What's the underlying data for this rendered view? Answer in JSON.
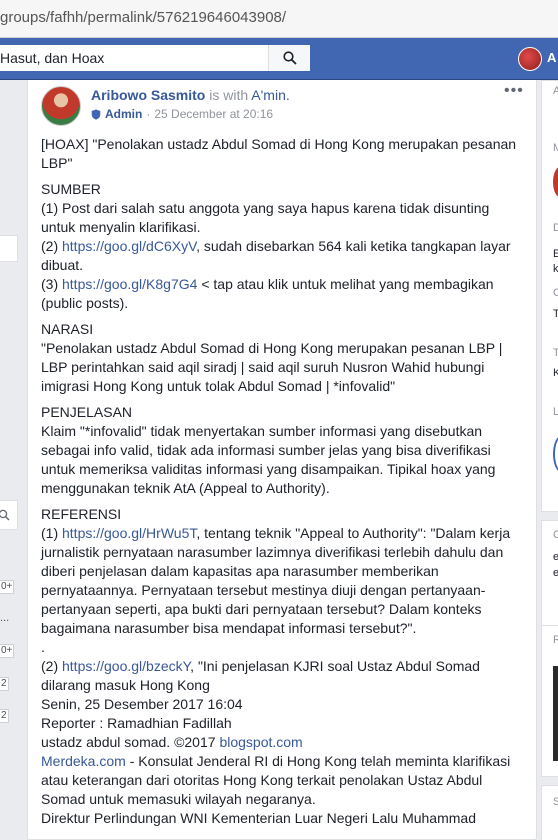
{
  "browser": {
    "url": "groups/fafhh/permalink/576219646043908/"
  },
  "topbar": {
    "search_text": "Hasut, dan Hoax",
    "user_initial": "A"
  },
  "left_sidebar": {
    "badges": [
      "0+",
      "0+",
      "2",
      "2"
    ],
    "ellipsis": "..."
  },
  "right_sidebar": {
    "letters": [
      "A",
      "M",
      "D",
      "E",
      "k",
      "C",
      "T",
      "T",
      "K",
      "L",
      "C",
      "e",
      "e",
      "R",
      "S"
    ]
  },
  "post": {
    "author": "Aribowo Sasmito",
    "with_text": "is with",
    "with_place": "A'min.",
    "role": "Admin",
    "separator": "·",
    "timestamp": "25 December at 20:16",
    "more": "•••",
    "content": {
      "headline": "[HOAX] \"Penolakan ustadz Abdul Somad di Hong Kong merupakan pesanan LBP\"",
      "sumber_title": "SUMBER",
      "sumber_1": "(1) Post dari salah satu anggota yang saya hapus karena tidak disunting untuk menyalin klarifikasi.",
      "sumber_2_prefix": "(2) ",
      "sumber_2_link": "https://goo.gl/dC6XyV",
      "sumber_2_rest": ", sudah disebarkan 564 kali ketika tangkapan layar dibuat.",
      "sumber_3_prefix": "(3) ",
      "sumber_3_link": "https://goo.gl/K8g7G4",
      "sumber_3_rest": " < tap atau klik untuk melihat yang membagikan (public posts).",
      "narasi_title": "NARASI",
      "narasi_text": "\"Penolakan ustadz Abdul Somad di Hong Kong merupakan pesanan LBP | LBP perintahkan said aqil siradj | said aqil suruh Nusron Wahid hubungi imigrasi Hong Kong untuk tolak Abdul Somad | *infovalid\"",
      "penjelasan_title": "PENJELASAN",
      "penjelasan_text": "Klaim \"*infovalid\" tidak menyertakan sumber informasi yang disebutkan sebagai info valid, tidak ada informasi sumber jelas yang bisa diverifikasi untuk memeriksa validitas informasi yang disampaikan. Tipikal hoax yang menggunakan teknik AtA (Appeal to Authority).",
      "referensi_title": "REFERENSI",
      "ref_1_prefix": "(1) ",
      "ref_1_link": "https://goo.gl/HrWu5T",
      "ref_1_rest": ", tentang teknik \"Appeal to Authority\": \"Dalam kerja jurnalistik pernyataan narasumber lazimnya diverifikasi terlebih dahulu dan diberi penjelasan dalam kapasitas apa narasumber memberikan pernyataannya. Pernyataan tersebut mestinya diuji dengan pertanyaan-pertanyaan seperti, apa bukti dari pernyataan tersebut? Dalam konteks bagaimana narasumber bisa mendapat informasi tersebut?\".",
      "dot": ".",
      "ref_2_prefix": "(2) ",
      "ref_2_link": "https://goo.gl/bzeckY",
      "ref_2_rest": ", \"Ini penjelasan KJRI soal Ustaz Abdul Somad dilarang masuk Hong Kong",
      "ref_2_date": "Senin, 25 Desember 2017 16:04",
      "ref_2_reporter": "Reporter : Ramadhian Fadillah",
      "ref_2_copy_prefix": "ustadz abdul somad. ©2017 ",
      "ref_2_copy_link": "blogspot.com",
      "ref_2_merdeka_link": "Merdeka.com",
      "ref_2_merdeka_rest": " - Konsulat Jenderal RI di Hong Kong telah meminta klarifikasi atau keterangan dari otoritas Hong Kong terkait penolakan Ustaz Abdul Somad untuk memasuki wilayah negaranya.",
      "ref_2_last": "Direktur Perlindungan WNI Kementerian Luar Negeri Lalu Muhammad"
    }
  }
}
